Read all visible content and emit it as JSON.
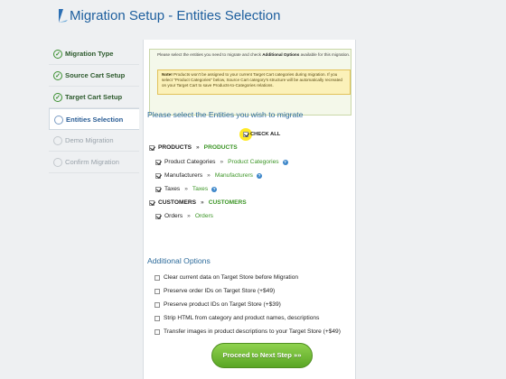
{
  "header": {
    "title": "Migration Setup - Entities Selection"
  },
  "sidebar": {
    "steps": [
      {
        "label": "Migration Type",
        "state": "done"
      },
      {
        "label": "Source Cart Setup",
        "state": "done"
      },
      {
        "label": "Target Cart Setup",
        "state": "done"
      },
      {
        "label": "Entities Selection",
        "state": "current"
      },
      {
        "label": "Demo Migration",
        "state": "future"
      },
      {
        "label": "Confirm Migration",
        "state": "future"
      }
    ]
  },
  "info": {
    "intro_pre": "Please select the entities you need to migrate and check ",
    "intro_bold": "Additional Options",
    "intro_post": " available for this migration.",
    "note_label": "Note!",
    "note_text": " Products won't be assigned to your current Target Cart categories during migration. If you select \"Product Categories\" below, Source Cart category's structure will be automatically recreated on your Target Cart to save Products-to-Categories relations."
  },
  "entities": {
    "heading": "Please select the Entities you wish to migrate",
    "check_all": "CHECK ALL",
    "items": [
      {
        "source": "PRODUCTS",
        "target": "PRODUCTS",
        "checked": true,
        "bold": true,
        "help": false
      },
      {
        "source": "Product Categories",
        "target": "Product Categories",
        "checked": true,
        "bold": false,
        "help": true
      },
      {
        "source": "Manufacturers",
        "target": "Manufacturers",
        "checked": true,
        "bold": false,
        "help": true
      },
      {
        "source": "Taxes",
        "target": "Taxes",
        "checked": true,
        "bold": false,
        "help": true
      },
      {
        "source": "CUSTOMERS",
        "target": "CUSTOMERS",
        "checked": true,
        "bold": true,
        "help": false
      },
      {
        "source": "Orders",
        "target": "Orders",
        "checked": true,
        "bold": false,
        "help": false
      }
    ],
    "separator": "»"
  },
  "additional": {
    "heading": "Additional Options",
    "options": [
      "Clear current data on Target Store before Migration",
      "Preserve order IDs on Target Store (+$49)",
      "Preserve product IDs on Target Store (+$39)",
      "Strip HTML from category and product names, descriptions",
      "Transfer images in product descriptions to your Target Store (+$49)"
    ]
  },
  "footer": {
    "proceed_label": "Proceed to Next Step »»"
  },
  "colors": {
    "accent_blue": "#1e5f9e",
    "success_green": "#3a9424",
    "button_green": "#5aa624",
    "note_yellow": "#fbf1b9"
  }
}
